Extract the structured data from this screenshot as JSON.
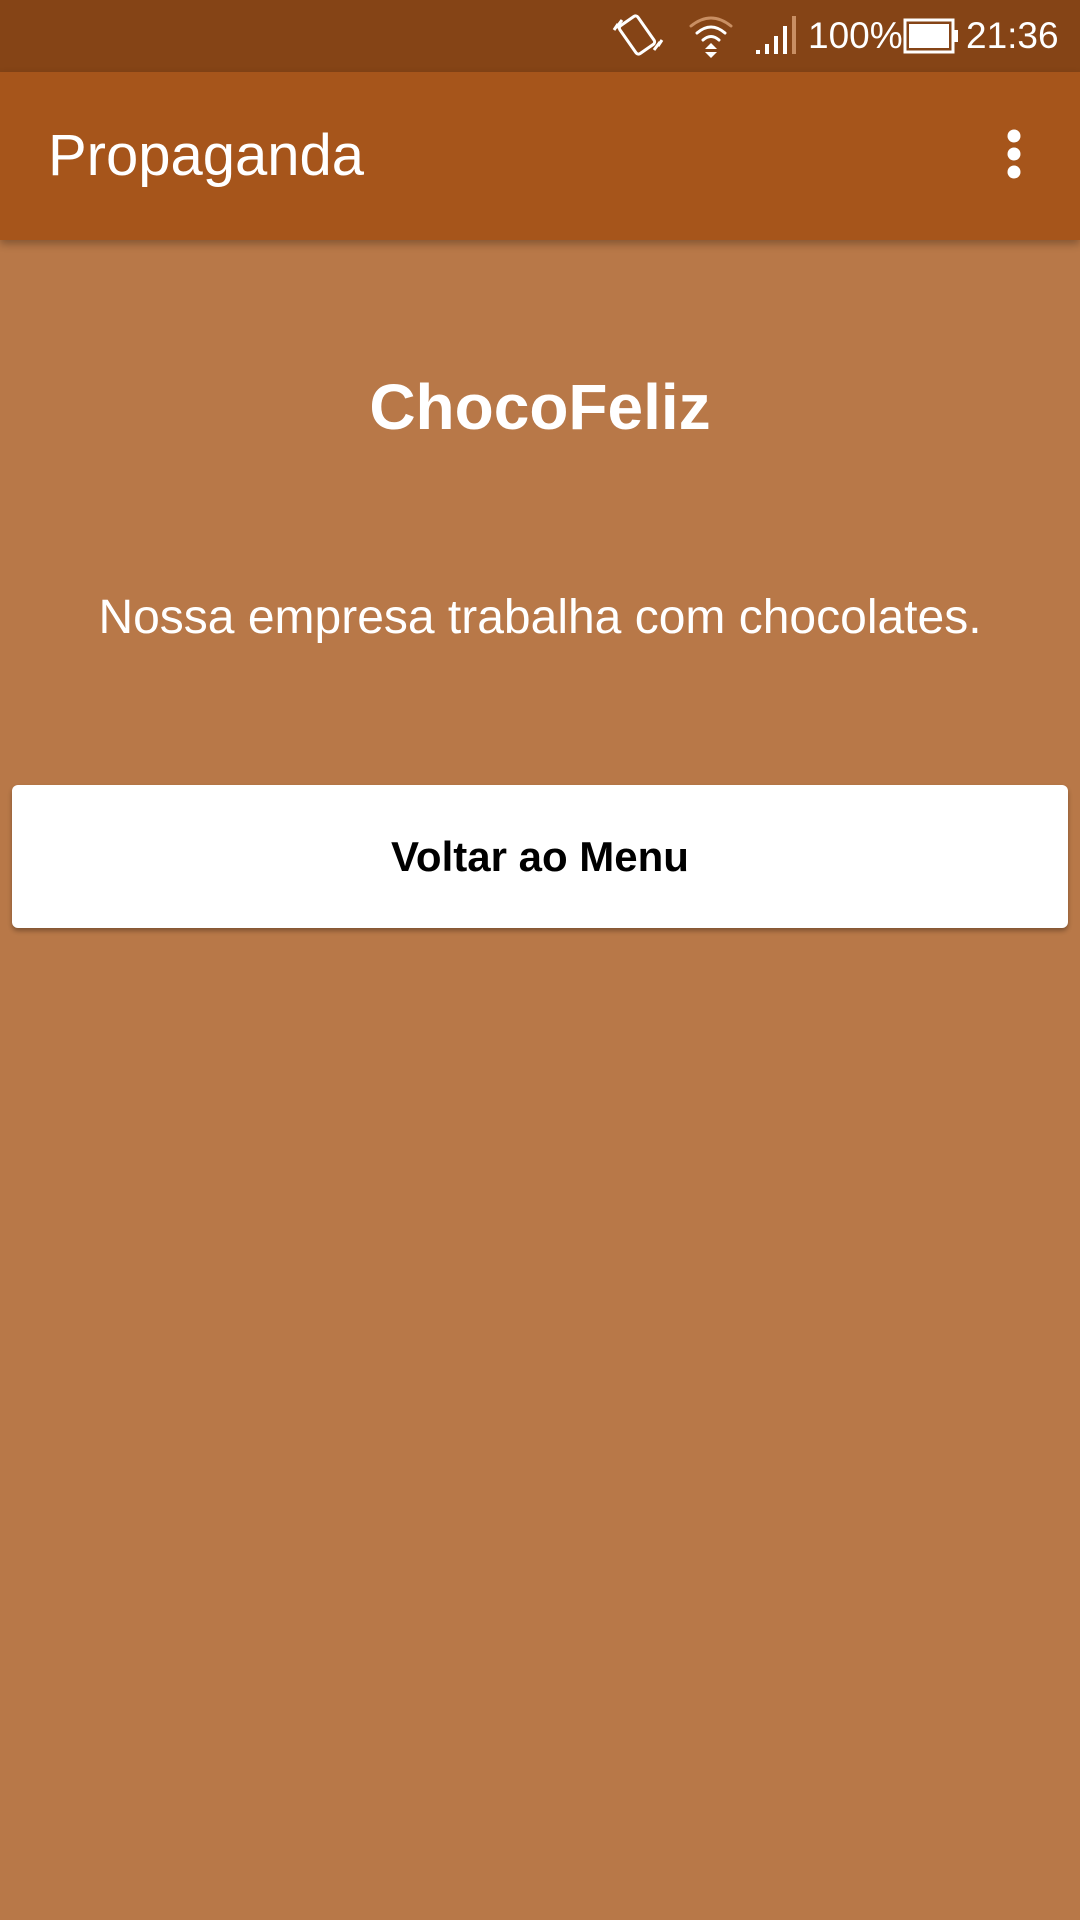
{
  "status_bar": {
    "battery_percent": "100%",
    "time": "21:36",
    "icons": [
      "vibrate-icon",
      "wifi-icon",
      "cell-signal-icon",
      "battery-icon"
    ],
    "background": "#854416"
  },
  "app_bar": {
    "title": "Propaganda",
    "menu_icon": "more-vert-icon",
    "background": "#a6551b"
  },
  "main": {
    "heading": "ChocoFeliz",
    "description": "Nossa empresa trabalha com chocolates.",
    "back_button_label": "Voltar ao Menu",
    "background": "#b87848"
  }
}
